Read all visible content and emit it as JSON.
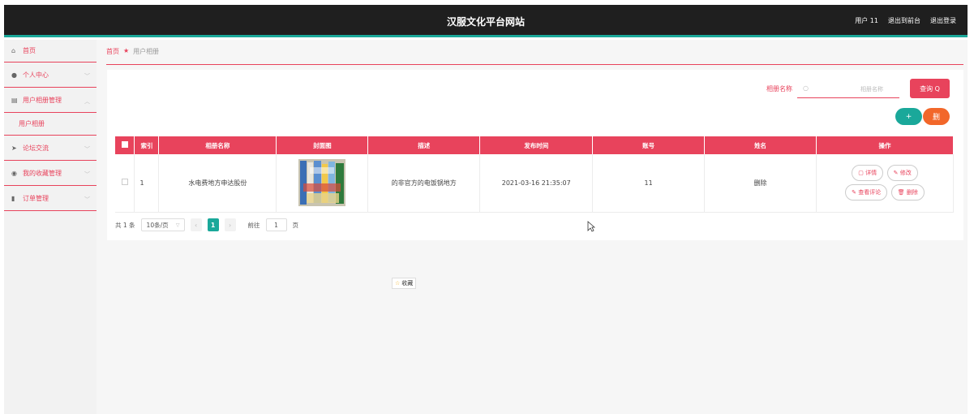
{
  "header": {
    "title": "汉服文化平台网站",
    "user": "用户 11",
    "back_to_admin": "退出到前台",
    "logout": "退出登录"
  },
  "sidebar": {
    "items": [
      {
        "icon": "home-icon",
        "label": "首页"
      },
      {
        "icon": "user-icon",
        "label": "个人中心"
      },
      {
        "icon": "album-icon",
        "label": "用户相册管理"
      },
      {
        "icon": "send-icon",
        "label": "论坛交流"
      },
      {
        "icon": "location-icon",
        "label": "我的收藏管理"
      },
      {
        "icon": "bar-chart-icon",
        "label": "订单管理"
      }
    ],
    "subitem": "用户相册"
  },
  "breadcrumb": {
    "home": "首页",
    "current": "用户相册"
  },
  "search": {
    "label": "相册名称",
    "placeholder": "相册名称",
    "button": "查询 Q"
  },
  "actions": {
    "add": "+",
    "delete": "删"
  },
  "table": {
    "headers": [
      "索引",
      "相册名称",
      "封面图",
      "描述",
      "发布时间",
      "账号",
      "姓名",
      "操作"
    ],
    "rows": [
      {
        "index": "1",
        "name": "水电费地方申达股份",
        "description": "的非官方的电饭锅地方",
        "time": "2021-03-16 21:35:07",
        "account": "11",
        "realname": "删除",
        "ops": {
          "detail": "详情",
          "edit": "修改",
          "comments": "查看评论",
          "delete": "删除"
        }
      }
    ]
  },
  "pager": {
    "total": "共 1 条",
    "page_size": "10条/页",
    "current_page": "1",
    "goto_label": "前往",
    "goto_value": "1",
    "page_unit": "页"
  },
  "favorite": {
    "label": "收藏"
  },
  "colors": {
    "accent": "#e8435c",
    "teal": "#1aa89a",
    "orange": "#f2672a",
    "header_bg": "#1f1f1f"
  }
}
